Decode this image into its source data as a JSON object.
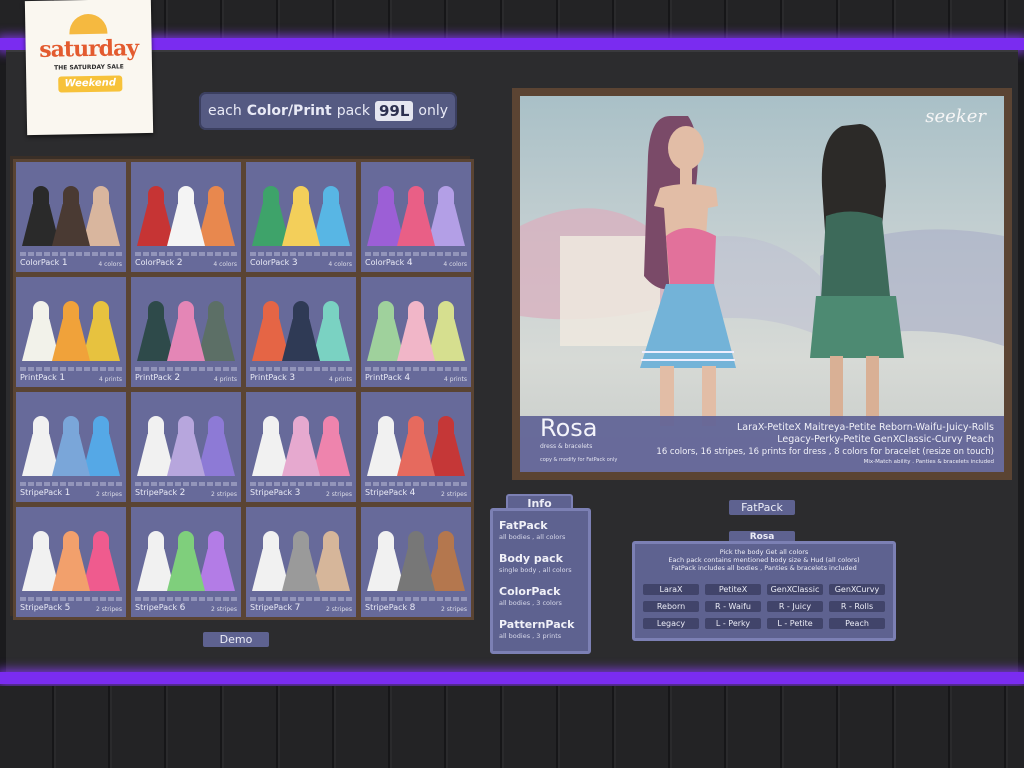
{
  "logo": {
    "main": "saturday",
    "tagline": "THE SATURDAY SALE",
    "badge": "Weekend"
  },
  "price": {
    "prefix": "each",
    "bold": "Color/Print",
    "mid": "pack",
    "amount": "99L",
    "suffix": "only"
  },
  "colors": {
    "neon": "#7a2cf0",
    "panel": "#5e6290",
    "tile": "#676a9a",
    "frame": "#5a4433"
  },
  "packs": [
    {
      "name": "ColorPack",
      "num": "1",
      "count": "4 colors",
      "colors": [
        "#2a2a2a",
        "#4a3a33",
        "#d9b69e"
      ]
    },
    {
      "name": "ColorPack",
      "num": "2",
      "count": "4 colors",
      "colors": [
        "#c63434",
        "#f4f4f4",
        "#e8884e"
      ]
    },
    {
      "name": "ColorPack",
      "num": "3",
      "count": "4 colors",
      "colors": [
        "#3ea36a",
        "#f3cf5a",
        "#58b6e4"
      ]
    },
    {
      "name": "ColorPack",
      "num": "4",
      "count": "4 colors",
      "colors": [
        "#9c5fd6",
        "#e95f86",
        "#b39fe6"
      ]
    },
    {
      "name": "PrintPack",
      "num": "1",
      "count": "4 prints",
      "colors": [
        "#f2f2ea",
        "#f0a23a",
        "#e7c23f"
      ]
    },
    {
      "name": "PrintPack",
      "num": "2",
      "count": "4 prints",
      "colors": [
        "#2e4a4a",
        "#e486b6",
        "#5c6f66"
      ]
    },
    {
      "name": "PrintPack",
      "num": "3",
      "count": "4 prints",
      "colors": [
        "#e56545",
        "#2f3a55",
        "#7ad2c2"
      ]
    },
    {
      "name": "PrintPack",
      "num": "4",
      "count": "4 prints",
      "colors": [
        "#9fd19c",
        "#f1b6c8",
        "#d6df8f"
      ]
    },
    {
      "name": "StripePack",
      "num": "1",
      "count": "2 stripes",
      "colors": [
        "#f1f1f1",
        "#7aa6d9",
        "#55a8e6"
      ]
    },
    {
      "name": "StripePack",
      "num": "2",
      "count": "2 stripes",
      "colors": [
        "#f1f1f1",
        "#b7a6dd",
        "#8d7ad6"
      ]
    },
    {
      "name": "StripePack",
      "num": "3",
      "count": "2 stripes",
      "colors": [
        "#f1f1f1",
        "#e6a9cf",
        "#ee84ad"
      ]
    },
    {
      "name": "StripePack",
      "num": "4",
      "count": "2 stripes",
      "colors": [
        "#f1f1f1",
        "#e66a5e",
        "#c53737"
      ]
    },
    {
      "name": "StripePack",
      "num": "5",
      "count": "2 stripes",
      "colors": [
        "#f1f1f1",
        "#f2a06c",
        "#ef5b8e"
      ]
    },
    {
      "name": "StripePack",
      "num": "6",
      "count": "2 stripes",
      "colors": [
        "#f1f1f1",
        "#7fcf7c",
        "#b37ce6"
      ]
    },
    {
      "name": "StripePack",
      "num": "7",
      "count": "2 stripes",
      "colors": [
        "#f1f1f1",
        "#9a9a9a",
        "#d6b69a"
      ]
    },
    {
      "name": "StripePack",
      "num": "8",
      "count": "2 stripes",
      "colors": [
        "#f1f1f1",
        "#777777",
        "#b4774e"
      ]
    }
  ],
  "demo_label": "Demo",
  "hero": {
    "brand": "seeker",
    "title": "Rosa",
    "subtitle": "dress & bracelets",
    "copy": "copy & modify for FatPack only",
    "bodies_line1": "LaraX-PetiteX  Maitreya-Petite  Reborn-Waifu-Juicy-Rolls",
    "bodies_line2": "Legacy-Perky-Petite  GenXClassic-Curvy  Peach",
    "counts_line": "16 colors, 16 stripes, 16 prints for dress , 8 colors for bracelet (resize on touch)",
    "note_line": "Mix-Match ability . Panties & bracelets included"
  },
  "fatpack_label": "FatPack",
  "info": {
    "tab": "Info",
    "items": [
      {
        "title": "FatPack",
        "sub": "all bodies , all colors"
      },
      {
        "title": "Body pack",
        "sub": "single body , all colors"
      },
      {
        "title": "ColorPack",
        "sub": "all bodies , 3 colors"
      },
      {
        "title": "PatternPack",
        "sub": "all bodies , 3 prints"
      }
    ]
  },
  "panel": {
    "tab": "Rosa",
    "line1": "Pick the body Get all colors",
    "line2": "Each pack contains mentioned body size & Hud (all colors)",
    "line3": "FatPack includes all bodies , Panties & bracelets included",
    "buttons": [
      "LaraX",
      "PetiteX",
      "GenXClassic",
      "GenXCurvy",
      "Reborn",
      "R - Waifu",
      "R - Juicy",
      "R - Rolls",
      "Legacy",
      "L - Perky",
      "L - Petite",
      "Peach"
    ]
  }
}
